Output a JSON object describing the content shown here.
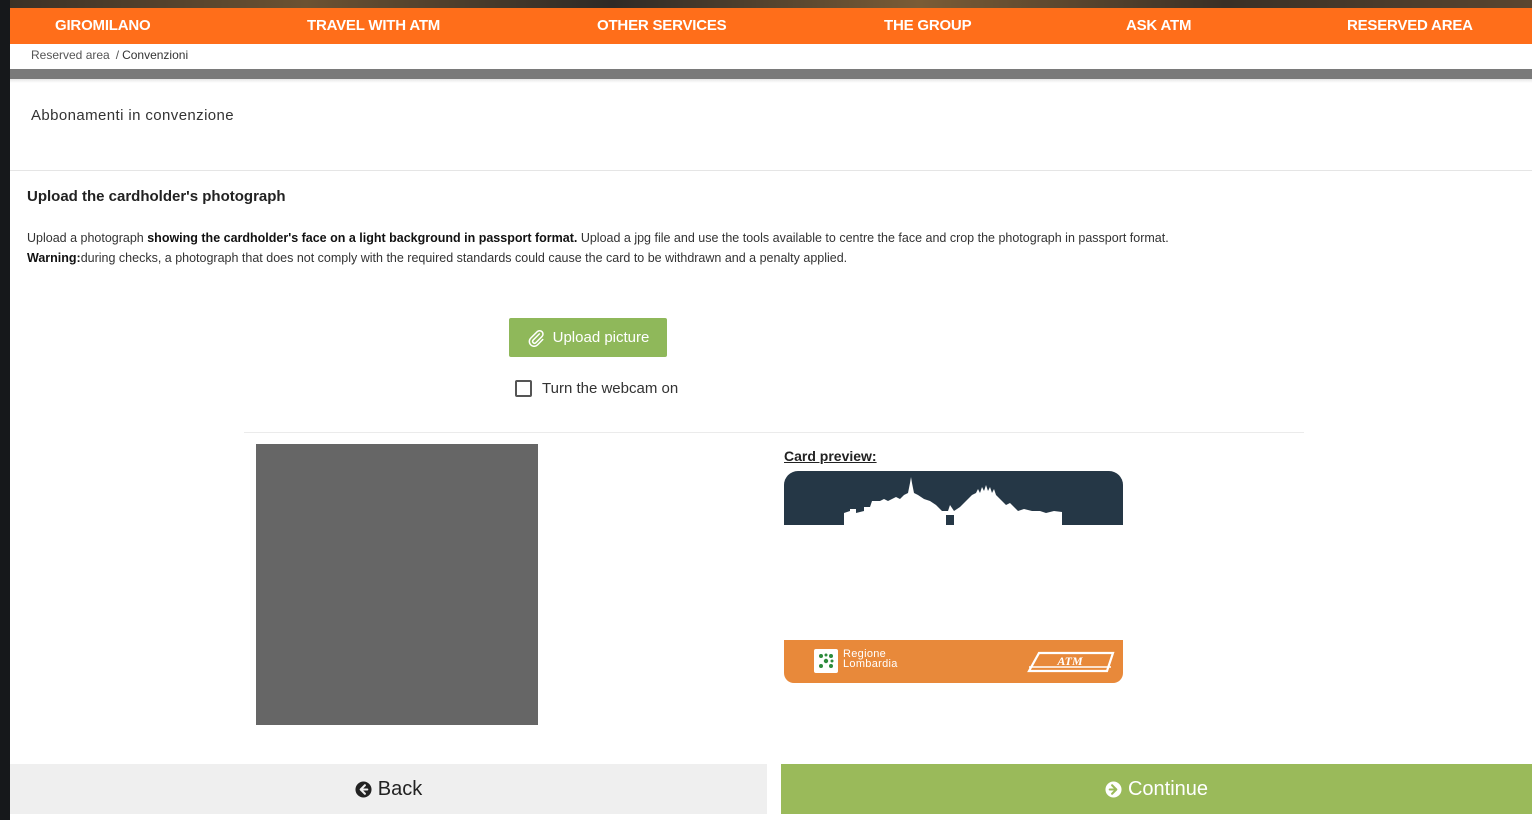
{
  "nav": {
    "items": [
      {
        "label": "GIROMILANO"
      },
      {
        "label": "TRAVEL WITH ATM"
      },
      {
        "label": "OTHER SERVICES"
      },
      {
        "label": "THE GROUP"
      },
      {
        "label": "ASK ATM"
      },
      {
        "label": "RESERVED AREA"
      }
    ]
  },
  "breadcrumb": {
    "parent": "Reserved area",
    "separator": "/",
    "current": "Convenzioni"
  },
  "section_title": "Abbonamenti in convenzione",
  "upload": {
    "heading": "Upload the cardholder's photograph",
    "desc_intro": "Upload a photograph ",
    "desc_bold": "showing the cardholder's face on a light background in passport format.",
    "desc_rest": " Upload a jpg file and use the tools available to centre the face and crop the photograph in passport format.",
    "warning_label": "Warning:",
    "warning_text": "during checks, a photograph that does not comply with the required standards could cause the card to be withdrawn and a penalty applied.",
    "button_label": "Upload picture",
    "webcam_label": "Turn the webcam on",
    "webcam_checked": false
  },
  "preview": {
    "label": "Card preview:",
    "region_line1": "Regione",
    "region_line2": "Lombardia",
    "brand_text": "ATM"
  },
  "footer": {
    "back_label": "Back",
    "continue_label": "Continue"
  },
  "colors": {
    "nav_bg": "#ff6e1a",
    "upload_btn": "#8fb85a",
    "continue_btn": "#9aba5a",
    "card_top": "#253746",
    "card_bottom": "#e8893a"
  }
}
